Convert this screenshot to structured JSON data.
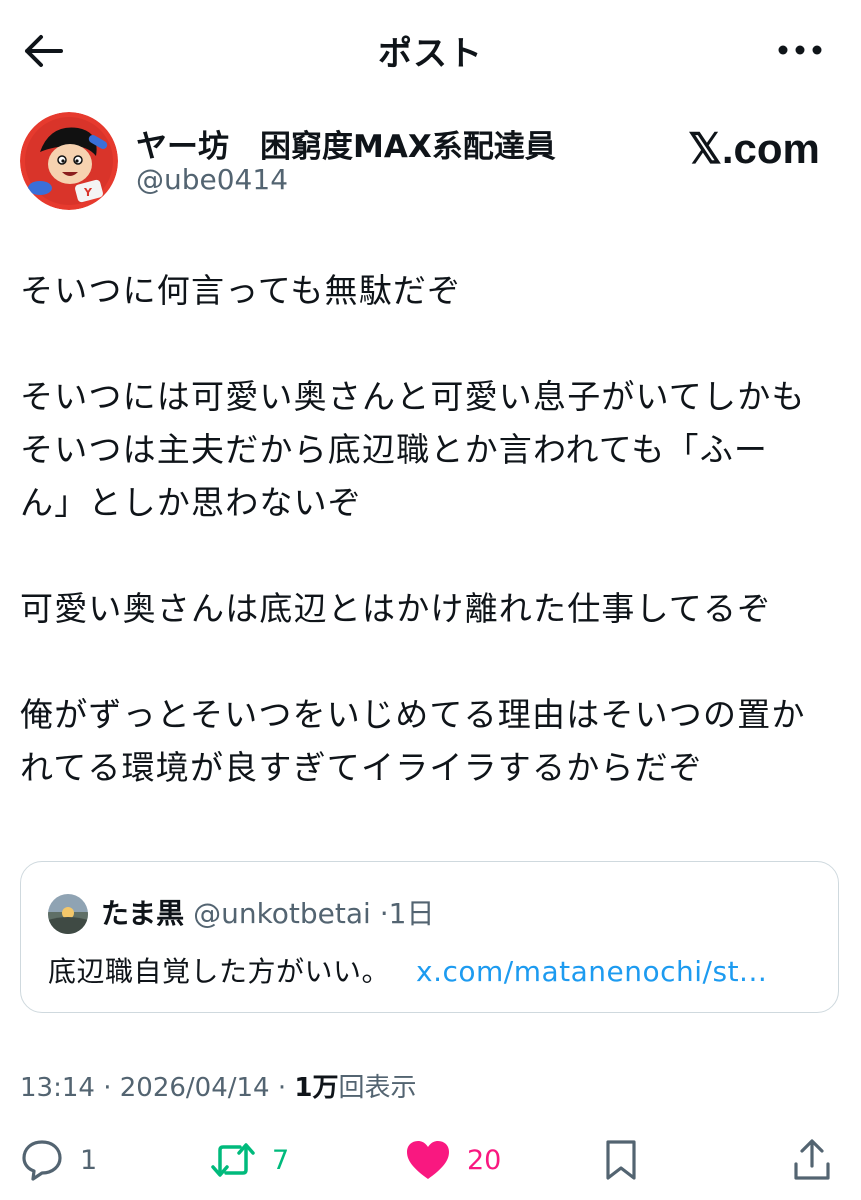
{
  "header": {
    "title": "ポスト"
  },
  "author": {
    "display_name": "ヤー坊　困窮度MAX系配達員",
    "handle": "@ube0414",
    "brand_label": "𝕏.com"
  },
  "post": {
    "paragraphs": [
      [
        "そいつに何言っても無駄だぞ"
      ],
      [
        "そいつには可愛い奥さんと可愛い息子がいてしかも",
        "そいつは主夫だから底辺職とか言われても「ふー",
        "ん」としか思わないぞ"
      ],
      [
        "可愛い奥さんは底辺とはかけ離れた仕事してるぞ"
      ],
      [
        "俺がずっとそいつをいじめてる理由はそいつの置か",
        "れてる環境が良すぎてイライラするからだぞ"
      ]
    ]
  },
  "quote": {
    "name": "たま黒",
    "handle": "@unkotbetai",
    "separator": "·",
    "time": "1日",
    "text": "底辺職自覚した方がいい。",
    "link": "x.com/matanenochi/st..."
  },
  "meta": {
    "time": "13:14",
    "separator": "·",
    "date": "2026/04/14",
    "views_count": "1万",
    "views_label": "回表示"
  },
  "actions": {
    "reply_count": "1",
    "repost_count": "7",
    "like_count": "20"
  },
  "colors": {
    "text": "#0f1419",
    "secondary": "#536471",
    "link": "#1d9bf0",
    "repost": "#00ba7c",
    "like": "#f91880",
    "border": "#cfd9de"
  },
  "icons": {
    "back": "arrow-left-icon",
    "more": "more-horizontal-icon",
    "reply": "speech-bubble-icon",
    "repost": "repost-arrows-icon",
    "like": "heart-icon",
    "bookmark": "bookmark-icon",
    "share": "share-upload-icon"
  }
}
